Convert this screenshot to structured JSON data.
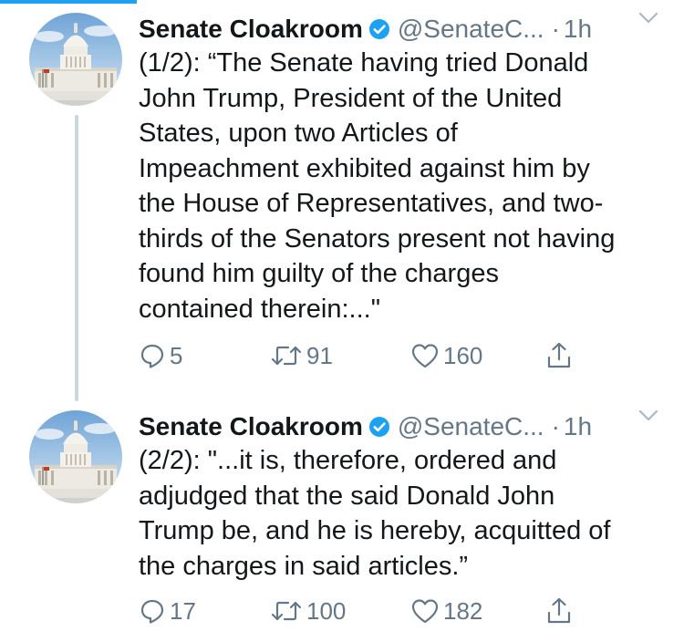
{
  "accent_color": "#1da1f2",
  "text_color": "#14171a",
  "secondary_color": "#657786",
  "tweets": [
    {
      "avatar_icon": "capitol-building-avatar",
      "name": "Senate Cloakroom",
      "verified_icon": "verified-badge-icon",
      "handle": "@SenateC...",
      "separator": "·",
      "time": "1h",
      "text_lines": [
        "(1/2): “The Senate having tried Donald",
        "John Trump, President of the United",
        "States, upon two Articles of",
        "Impeachment exhibited against him by",
        "the House of Representatives, and two-",
        "thirds of the Senators present not having",
        "found him guilty of the charges",
        "contained therein:...\""
      ],
      "replies": "5",
      "retweets": "91",
      "likes": "160"
    },
    {
      "avatar_icon": "capitol-building-avatar",
      "name": "Senate Cloakroom",
      "verified_icon": "verified-badge-icon",
      "handle": "@SenateC...",
      "separator": "·",
      "time": "1h",
      "text_lines": [
        "(2/2): \"...it is, therefore, ordered and",
        "adjudged that the said Donald John",
        "Trump be, and he is hereby, acquitted of",
        "the charges in said articles.”"
      ],
      "replies": "17",
      "retweets": "100",
      "likes": "182"
    }
  ]
}
